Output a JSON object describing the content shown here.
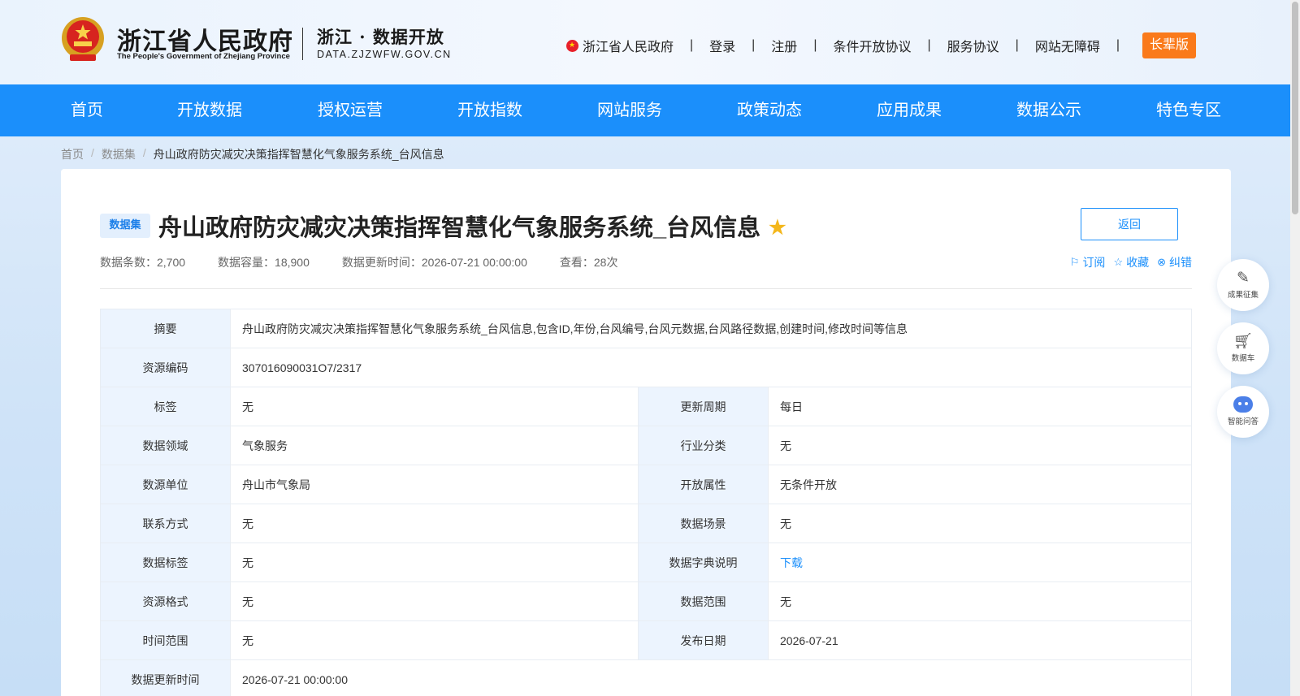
{
  "header": {
    "logo_cn": "浙江省人民政府",
    "logo_en": "The People's Government of Zhejiang Province",
    "sub_cn": "浙江 · 数据开放",
    "sub_en": "DATA.ZJZWFW.GOV.CN",
    "links": {
      "gov": "浙江省人民政府",
      "login": "登录",
      "register": "注册",
      "conditional_agreement": "条件开放协议",
      "service_agreement": "服务协议",
      "accessibility": "网站无障碍",
      "elder": "长辈版"
    },
    "separator": "|"
  },
  "nav": {
    "items": [
      "首页",
      "开放数据",
      "授权运营",
      "开放指数",
      "网站服务",
      "政策动态",
      "应用成果",
      "数据公示",
      "特色专区"
    ]
  },
  "breadcrumb": {
    "home": "首页",
    "dataset": "数据集",
    "current": "舟山政府防灾减灾决策指挥智慧化气象服务系统_台风信息",
    "sep": "/"
  },
  "dataset": {
    "badge": "数据集",
    "title": "舟山政府防灾减灾决策指挥智慧化气象服务系统_台风信息",
    "back": "返回",
    "meta": {
      "count": "数据条数：2,700",
      "volume": "数据容量：18,900",
      "updated": "数据更新时间：2026-07-21 00:00:00",
      "views": "查看：28次"
    },
    "actions": {
      "subscribe": "订阅",
      "favorite": "收藏",
      "report": "纠错"
    }
  },
  "info": {
    "summary_label": "摘要",
    "summary_value": "舟山政府防灾减灾决策指挥智慧化气象服务系统_台风信息,包含ID,年份,台风编号,台风元数据,台风路径数据,创建时间,修改时间等信息",
    "code_label": "资源编码",
    "code_value": "307016090031O7/2317",
    "rows": [
      {
        "l1": "标签",
        "v1": "无",
        "l2": "更新周期",
        "v2": "每日"
      },
      {
        "l1": "数据领域",
        "v1": "气象服务",
        "l2": "行业分类",
        "v2": "无"
      },
      {
        "l1": "数源单位",
        "v1": "舟山市气象局",
        "l2": "开放属性",
        "v2": "无条件开放"
      },
      {
        "l1": "联系方式",
        "v1": "无",
        "l2": "数据场景",
        "v2": "无"
      },
      {
        "l1": "数据标签",
        "v1": "无",
        "l2": "数据字典说明",
        "v2": "下载"
      },
      {
        "l1": "资源格式",
        "v1": "无",
        "l2": "数据范围",
        "v2": "无"
      },
      {
        "l1": "时间范围",
        "v1": "无",
        "l2": "发布日期",
        "v2": "2026-07-21"
      }
    ],
    "update_label": "数据更新时间",
    "update_value": "2026-07-21 00:00:00"
  },
  "floating": {
    "collect": "成果征集",
    "cart": "数据车",
    "qa": "智能问答"
  },
  "colors": {
    "nav_blue": "#1b8ffb",
    "elder_orange": "#fa7a1a",
    "star_gold": "#f4b71b"
  }
}
